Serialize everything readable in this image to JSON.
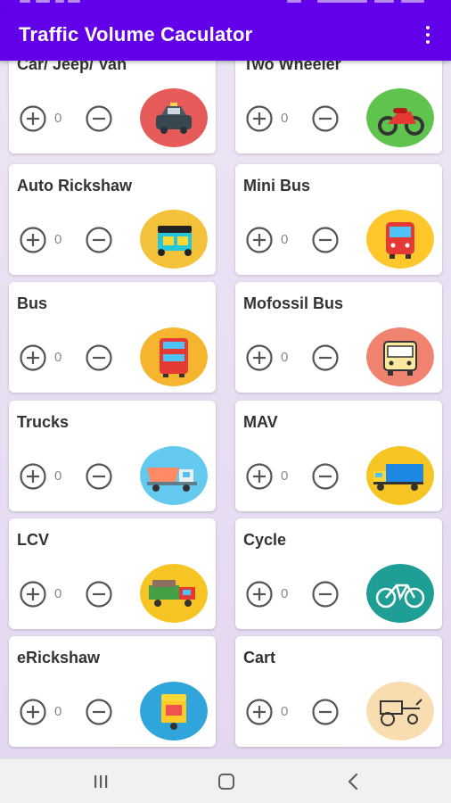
{
  "app": {
    "title": "Traffic Volume Caculator",
    "menu_icon": "more-vert-icon"
  },
  "colors": {
    "primary": "#6200ea",
    "card": "#ffffff",
    "background": "#e9e0f3"
  },
  "vehicles": [
    {
      "name": "Car/ Jeep/ Van",
      "count": "0",
      "icon": "car-icon",
      "icon_bg": "#e65a5a"
    },
    {
      "name": "Two Wheeler",
      "count": "0",
      "icon": "motorcycle-icon",
      "icon_bg": "#5ec44d"
    },
    {
      "name": "Auto Rickshaw",
      "count": "0",
      "icon": "auto-rickshaw-icon",
      "icon_bg": "#f4c23a"
    },
    {
      "name": "Mini Bus",
      "count": "0",
      "icon": "mini-bus-icon",
      "icon_bg": "#ffc72b"
    },
    {
      "name": "Bus",
      "count": "0",
      "icon": "double-decker-bus-icon",
      "icon_bg": "#f6b52f"
    },
    {
      "name": "Mofossil Bus",
      "count": "0",
      "icon": "bus-icon",
      "icon_bg": "#f08370"
    },
    {
      "name": "Trucks",
      "count": "0",
      "icon": "dump-truck-icon",
      "icon_bg": "#63c9ee"
    },
    {
      "name": "MAV",
      "count": "0",
      "icon": "container-truck-icon",
      "icon_bg": "#f6c524"
    },
    {
      "name": "LCV",
      "count": "0",
      "icon": "light-truck-icon",
      "icon_bg": "#f6c524"
    },
    {
      "name": "Cycle",
      "count": "0",
      "icon": "bicycle-icon",
      "icon_bg": "#1e9e95"
    },
    {
      "name": "eRickshaw",
      "count": "0",
      "icon": "e-rickshaw-icon",
      "icon_bg": "#2fa5dc"
    },
    {
      "name": "Cart",
      "count": "0",
      "icon": "horse-cart-icon",
      "icon_bg": "#f8ddb0"
    }
  ],
  "nav": {
    "recents_icon": "recents-icon",
    "home_icon": "home-icon",
    "back_icon": "back-icon"
  }
}
